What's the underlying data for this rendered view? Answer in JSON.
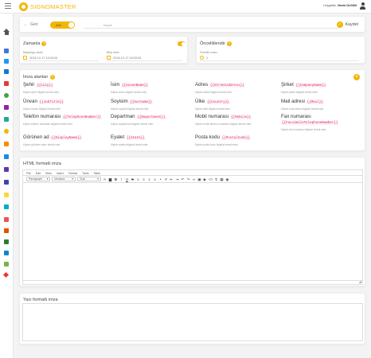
{
  "app": {
    "logo_text": "SIGNOMASTER",
    "user_prefix": "Hoşgeldin,",
    "user_name": "Nevin OLGUN"
  },
  "header": {
    "back_label": "Geri",
    "toggle_label": "Aktif",
    "search_placeholder": "Başlık",
    "save_label": "Kaydet"
  },
  "schedule": {
    "title": "Zamanla",
    "start_label": "Başlangıç tarihi",
    "start_value": "2018-12-17 16:03:00",
    "end_label": "Bitiş tarihi",
    "end_value": "2018-12-17 16:03:00"
  },
  "priority": {
    "title": "Önceliklendir",
    "label": "Öncelik sırası",
    "value": "1"
  },
  "signature_fields": {
    "title": "İmza alanları",
    "add_label": "+",
    "items": [
      {
        "name": "Şehir",
        "code": "{{City}}",
        "desc": "Kişinin şehir bilgisini temsil eder."
      },
      {
        "name": "İsim",
        "code": "{{GivenName}}",
        "desc": "Kişinin adını bilgisini temsil eder."
      },
      {
        "name": "Adres",
        "code": "{{StreetAddress}}",
        "desc": "Kişinin adres bilgisini temsil eder."
      },
      {
        "name": "Şirket",
        "code": "{{CompanyName}}",
        "desc": "Kişinin şirket bilgisini temsil eder."
      },
      {
        "name": "Ünvan",
        "code": "{{JobTitle}}",
        "desc": "Kişinin ünvan bilgisini temsil eder."
      },
      {
        "name": "Soyisim",
        "code": "{{Surname}}",
        "desc": "Kişinin soyadı bilgisini temsil eder."
      },
      {
        "name": "Ülke",
        "code": "{{Country}}",
        "desc": "Kişinin ülke bilgisini temsil eder."
      },
      {
        "name": "Mail adresi",
        "code": "{{Mail}}",
        "desc": "Kişinin mail adresi bilgisini temsil eder."
      },
      {
        "name": "Telefon numarası",
        "code": "{{TelephoneNumber}}",
        "desc": "Kişinin telefon numarası bilgisini temsil eder."
      },
      {
        "name": "Departman",
        "code": "{{Department}}",
        "desc": "Kişinin departman bilgisini temsil eder."
      },
      {
        "name": "Mobil numarası",
        "code": "{{Mobile}}",
        "desc": "Kişinin mobil telefon numarası bilgisini temsil eder."
      },
      {
        "name": "Fax numarası",
        "code": "{{FacsimileTelephoneNumber}}",
        "desc": "Kişinin fax numarası bilgisini temsil eder."
      },
      {
        "name": "Görünen ad",
        "code": "{{DisplayName}}",
        "desc": "Kişinin görünen adını temsil eder."
      },
      {
        "name": "Eyalet",
        "code": "{{State}}",
        "desc": "Kişinin eyalet bilgisini temsil eder."
      },
      {
        "name": "Posta kodu",
        "code": "{{PostalCode}}",
        "desc": "Kişinin posta kodu bilgisini temsil eder."
      }
    ]
  },
  "html_editor": {
    "title": "HTML formatlı imza",
    "menu": [
      "File",
      "Edit",
      "View",
      "Insert",
      "Format",
      "Tools",
      "Table"
    ],
    "format_select": "Paragraph",
    "font_select": "Verdana",
    "size_select": "11pt"
  },
  "text_signature": {
    "title": "Yazı formatlı imza"
  },
  "colors": {
    "accent": "#f2b705",
    "code_text": "#e0245e"
  }
}
